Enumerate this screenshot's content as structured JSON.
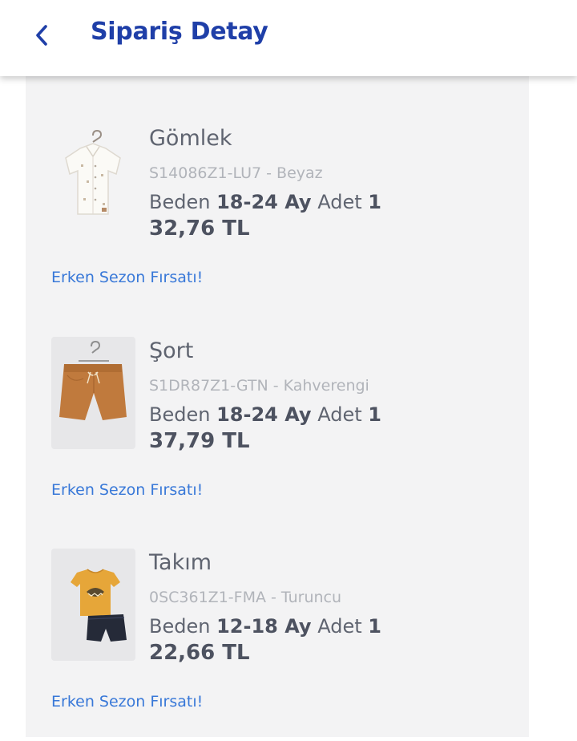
{
  "header": {
    "title": "Sipariş Detay",
    "back_icon": "chevron-left-icon"
  },
  "labels": {
    "size": "Beden",
    "quantity": "Adet"
  },
  "items": [
    {
      "name": "Gömlek",
      "code": "S14086Z1-LU7 - Beyaz",
      "size": "18-24 Ay",
      "quantity": "1",
      "price": "32,76 TL",
      "promo": "Erken Sezon Fırsatı!",
      "image_icon": "white-shirt-image"
    },
    {
      "name": "Şort",
      "code": "S1DR87Z1-GTN - Kahverengi",
      "size": "18-24 Ay",
      "quantity": "1",
      "price": "37,79 TL",
      "promo": "Erken Sezon Fırsatı!",
      "image_icon": "brown-shorts-image"
    },
    {
      "name": "Takım",
      "code": "0SC361Z1-FMA - Turuncu",
      "size": "12-18 Ay",
      "quantity": "1",
      "price": "22,66 TL",
      "promo": "Erken Sezon Fırsatı!",
      "image_icon": "tshirt-shorts-set-image"
    }
  ],
  "colors": {
    "title": "#1f3fa8",
    "promo": "#3878d8",
    "panel": "#f3f3f4",
    "text": "#5f6470"
  }
}
